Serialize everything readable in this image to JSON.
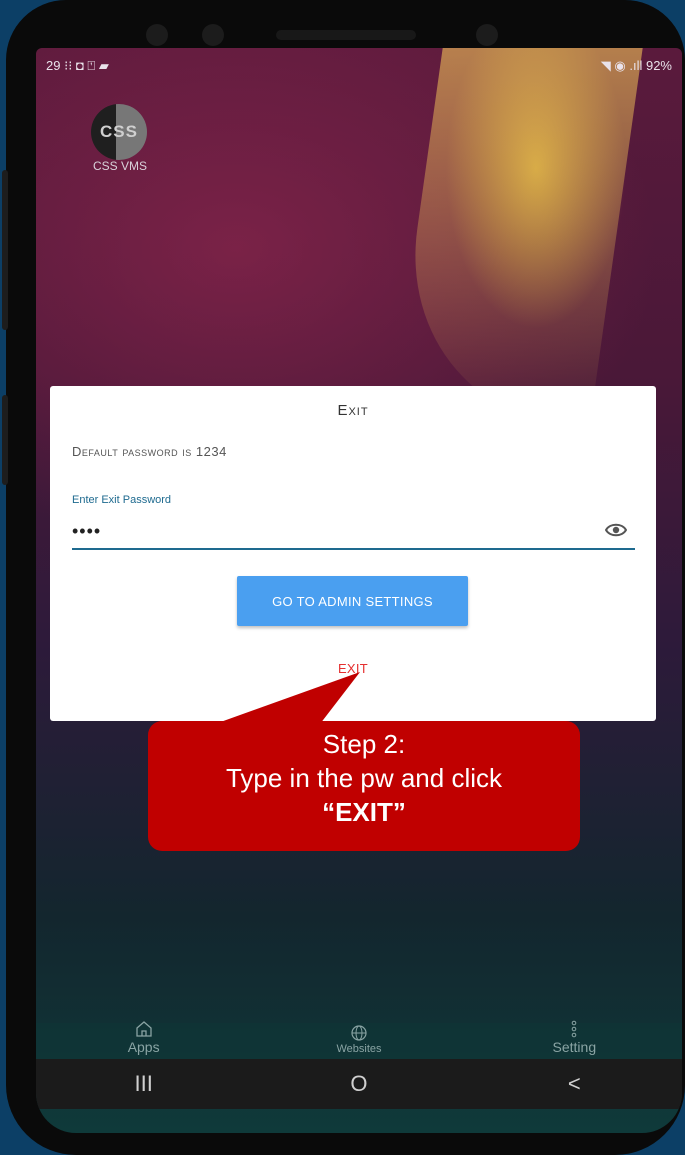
{
  "status_bar": {
    "left": "29 ⁝⁝ ◘ ⍞ ▰",
    "right": "◥ ◉ .ıll 92%"
  },
  "app": {
    "icon_text": "CSS",
    "label": "CSS VMS"
  },
  "dialog": {
    "title": "Exit",
    "hint": "Default password is 1234",
    "field_label": "Enter Exit Password",
    "password_value": "1234",
    "admin_button": "GO TO ADMIN SETTINGS",
    "exit_link": "EXIT"
  },
  "callout": {
    "line1": "Step 2:",
    "line2": "Type in the pw and click",
    "line3": "“EXIT”"
  },
  "dock": {
    "apps": "Apps",
    "websites": "Websites",
    "setting": "Setting"
  },
  "navbar": {
    "recents": "III",
    "home": "O",
    "back": "<"
  },
  "colors": {
    "accent": "#4a9ff0",
    "exit_red": "#e53030",
    "callout_red": "#c00000",
    "field_line": "#1e6a8f"
  }
}
